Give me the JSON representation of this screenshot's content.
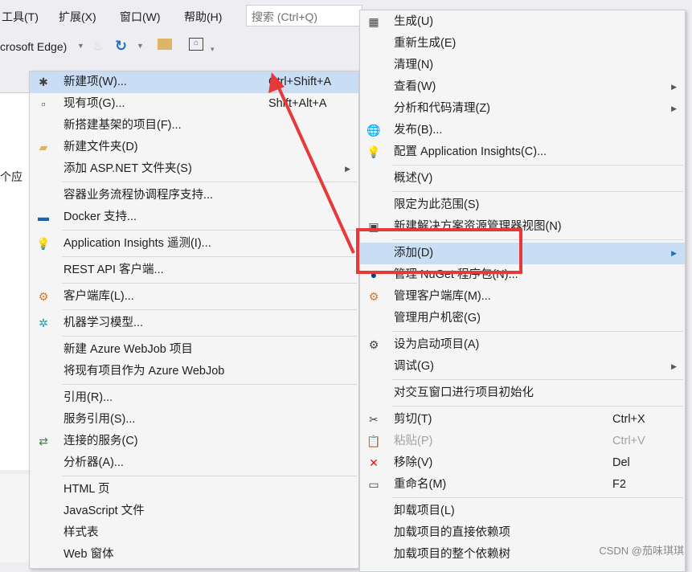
{
  "menubar": {
    "items": [
      "工具(T)",
      "扩展(X)",
      "窗口(W)",
      "帮助(H)"
    ],
    "search_placeholder": "搜索 (Ctrl+Q)"
  },
  "toolbar": {
    "browser": "crosoft Edge)"
  },
  "editor": {
    "text": "个应"
  },
  "left_menu": [
    {
      "label": "新建项(W)...",
      "shortcut": "Ctrl+Shift+A",
      "icon": "new-item-icon",
      "hl": true
    },
    {
      "label": "现有项(G)...",
      "shortcut": "Shift+Alt+A",
      "icon": "existing-item-icon"
    },
    {
      "label": "新搭建基架的项目(F)..."
    },
    {
      "label": "新建文件夹(D)",
      "icon": "new-folder-icon"
    },
    {
      "label": "添加 ASP.NET 文件夹(S)",
      "submenu": true
    },
    {
      "sep": true
    },
    {
      "label": "容器业务流程协调程序支持..."
    },
    {
      "label": "Docker 支持...",
      "icon": "docker-icon"
    },
    {
      "sep": true
    },
    {
      "label": "Application Insights 遥测(I)...",
      "icon": "insights-icon"
    },
    {
      "sep": true
    },
    {
      "label": "REST API 客户端..."
    },
    {
      "sep": true
    },
    {
      "label": "客户端库(L)...",
      "icon": "client-library-icon"
    },
    {
      "sep": true
    },
    {
      "label": "机器学习模型...",
      "icon": "ml-model-icon"
    },
    {
      "sep": true
    },
    {
      "label": "新建 Azure WebJob 项目"
    },
    {
      "label": "将现有项目作为 Azure WebJob"
    },
    {
      "sep": true
    },
    {
      "label": "引用(R)..."
    },
    {
      "label": "服务引用(S)..."
    },
    {
      "label": "连接的服务(C)",
      "icon": "connected-service-icon"
    },
    {
      "label": "分析器(A)..."
    },
    {
      "sep": true
    },
    {
      "label": "HTML 页"
    },
    {
      "label": "JavaScript 文件"
    },
    {
      "label": "样式表"
    },
    {
      "label": "Web 窗体"
    }
  ],
  "right_menu": [
    {
      "label": "生成(U)",
      "icon": "build-icon"
    },
    {
      "label": "重新生成(E)"
    },
    {
      "label": "清理(N)"
    },
    {
      "label": "查看(W)",
      "submenu": true
    },
    {
      "label": "分析和代码清理(Z)",
      "submenu": true
    },
    {
      "label": "发布(B)...",
      "icon": "publish-icon"
    },
    {
      "label": "配置 Application Insights(C)...",
      "icon": "insights-icon"
    },
    {
      "sep": true
    },
    {
      "label": "概述(V)"
    },
    {
      "sep": true
    },
    {
      "label": "限定为此范围(S)"
    },
    {
      "label": "新建解决方案资源管理器视图(N)",
      "icon": "new-view-icon"
    },
    {
      "sep": true
    },
    {
      "label": "添加(D)",
      "submenu": true,
      "hl": true
    },
    {
      "label": "管理 NuGet 程序包(N)...",
      "icon": "nuget-icon"
    },
    {
      "label": "管理客户端库(M)...",
      "icon": "client-library-icon"
    },
    {
      "label": "管理用户机密(G)"
    },
    {
      "sep": true
    },
    {
      "label": "设为启动项目(A)",
      "icon": "gear-icon"
    },
    {
      "label": "调试(G)",
      "submenu": true
    },
    {
      "sep": true
    },
    {
      "label": "对交互窗口进行项目初始化"
    },
    {
      "sep": true
    },
    {
      "label": "剪切(T)",
      "shortcut": "Ctrl+X",
      "icon": "scissors-icon"
    },
    {
      "label": "粘贴(P)",
      "shortcut": "Ctrl+V",
      "icon": "paste-icon",
      "disabled": true
    },
    {
      "label": "移除(V)",
      "shortcut": "Del",
      "icon": "remove-icon"
    },
    {
      "label": "重命名(M)",
      "shortcut": "F2",
      "icon": "rename-icon"
    },
    {
      "sep": true
    },
    {
      "label": "卸载项目(L)"
    },
    {
      "label": "加载项目的直接依赖项"
    },
    {
      "label": "加载项目的整个依赖树"
    }
  ],
  "watermark": "CSDN @茄味琪琪",
  "colors": {
    "highlight": "#c9def5",
    "annotation": "#e8393a"
  }
}
